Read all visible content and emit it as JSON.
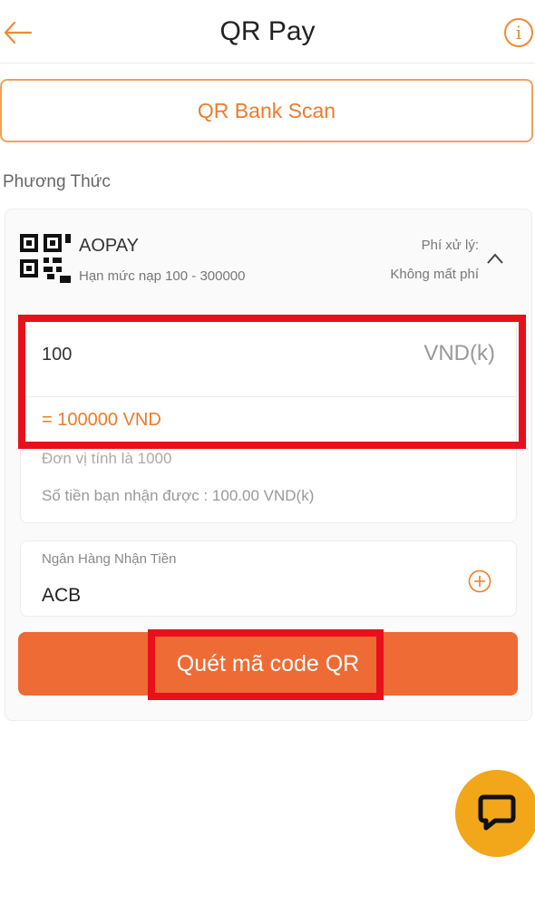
{
  "header": {
    "title": "QR Pay",
    "back_icon": "arrow-left-icon",
    "info_icon": "info-icon",
    "info_glyph": "i"
  },
  "qr_bank_scan": {
    "label": "QR Bank Scan"
  },
  "section": {
    "label": "Phương Thức"
  },
  "method": {
    "name": "AOPAY",
    "limit": "Hạn mức nạp 100 - 300000",
    "fee_label": "Phí xử lý:",
    "fee_value": "Không mất phí",
    "logo_icon": "qr-code-icon",
    "collapse_icon": "chevron-up-icon"
  },
  "amount": {
    "value": "100",
    "unit": "VND(k)",
    "converted": "= 100000 VND",
    "unit_note": "Đơn vị tính là 1000",
    "receive_note": "Số tiền bạn nhận được : 100.00 VND(k)"
  },
  "bank": {
    "label": "Ngân Hàng Nhận Tiền",
    "value": "ACB",
    "add_icon": "plus-circle-icon"
  },
  "cta": {
    "label": "Quét mã code QR"
  },
  "chat": {
    "icon": "chat-bubble-icon"
  },
  "colors": {
    "accent": "#ee7b2a",
    "cta": "#ee6b35",
    "highlight": "#e8101a",
    "chat": "#f2a619"
  }
}
